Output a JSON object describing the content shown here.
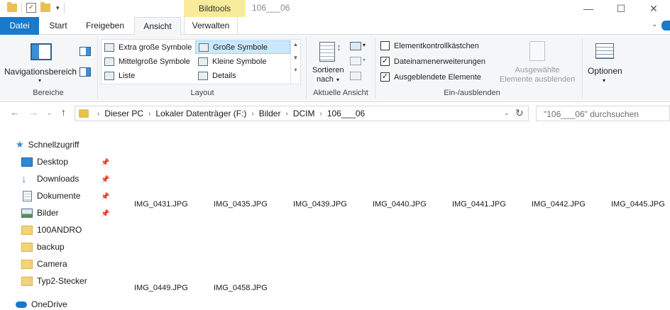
{
  "titlebar": {
    "context_tab": "Bildtools",
    "window_title": "106___06",
    "min_glyph": "—",
    "max_glyph": "☐",
    "close_glyph": "✕"
  },
  "tabs": [
    {
      "label": "Datei"
    },
    {
      "label": "Start"
    },
    {
      "label": "Freigeben"
    },
    {
      "label": "Ansicht"
    },
    {
      "label": "Verwalten"
    }
  ],
  "ribbon": {
    "bereiche": {
      "nav_pane_label": "Navigationsbereich",
      "group_label": "Bereiche"
    },
    "layout": {
      "items": [
        {
          "label": "Extra große Symbole"
        },
        {
          "label": "Große Symbole"
        },
        {
          "label": "Mittelgroße Symbole"
        },
        {
          "label": "Kleine Symbole"
        },
        {
          "label": "Liste"
        },
        {
          "label": "Details"
        }
      ],
      "selected": "Große Symbole",
      "group_label": "Layout"
    },
    "ansicht": {
      "sort_label_1": "Sortieren",
      "sort_label_2": "nach",
      "group_label": "Aktuelle Ansicht"
    },
    "einaus": {
      "checkboxes": [
        {
          "label": "Elementkontrollkästchen",
          "checked": false
        },
        {
          "label": "Dateinamenerweiterungen",
          "checked": true
        },
        {
          "label": "Ausgeblendete Elemente",
          "checked": true
        }
      ],
      "hide_selected_1": "Ausgewählte",
      "hide_selected_2": "Elemente ausblenden",
      "group_label": "Ein-/ausblenden"
    },
    "options_label": "Optionen"
  },
  "address": {
    "crumbs": [
      "Dieser PC",
      "Lokaler Datenträger (F:)",
      "Bilder",
      "DCIM",
      "106___06"
    ]
  },
  "search": {
    "placeholder": "\"106___06\" durchsuchen"
  },
  "sidebar": {
    "quick_access": "Schnellzugriff",
    "items": [
      {
        "label": "Desktop",
        "icon": "desktop-icon",
        "pinned": true
      },
      {
        "label": "Downloads",
        "icon": "download-icon",
        "pinned": true
      },
      {
        "label": "Dokumente",
        "icon": "document-icon",
        "pinned": true
      },
      {
        "label": "Bilder",
        "icon": "pictures-icon",
        "pinned": true
      },
      {
        "label": "100ANDRO",
        "icon": "folder-icon",
        "pinned": false
      },
      {
        "label": "backup",
        "icon": "folder-icon",
        "pinned": false
      },
      {
        "label": "Camera",
        "icon": "folder-icon",
        "pinned": false
      },
      {
        "label": "Typ2-Stecker",
        "icon": "folder-icon",
        "pinned": false
      }
    ],
    "onedrive": "OneDrive"
  },
  "files": [
    {
      "name": "IMG_0431.JPG"
    },
    {
      "name": "IMG_0435.JPG"
    },
    {
      "name": "IMG_0439.JPG"
    },
    {
      "name": "IMG_0440.JPG"
    },
    {
      "name": "IMG_0441.JPG"
    },
    {
      "name": "IMG_0442.JPG"
    },
    {
      "name": "IMG_0445.JPG"
    },
    {
      "name": "IMG_0449.JPG"
    },
    {
      "name": "IMG_0458.JPG"
    }
  ],
  "colors": {
    "accent": "#1979ca",
    "context_tab": "#f8eb9c",
    "selection": "#cce8ff",
    "folder": "#e8c14e"
  }
}
